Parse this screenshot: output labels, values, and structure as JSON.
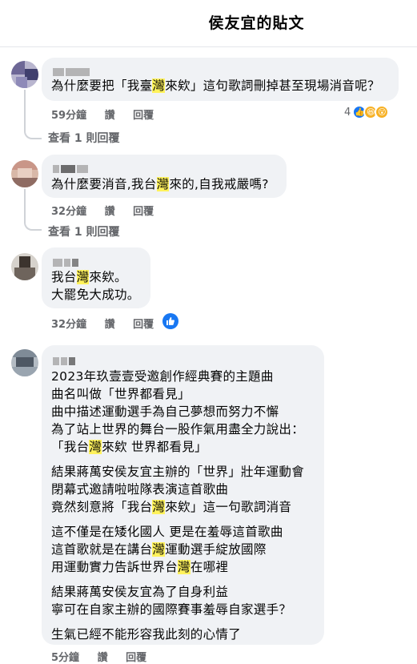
{
  "header": {
    "title": "侯友宜的貼文"
  },
  "comments": [
    {
      "text_lines": [
        [
          "為什麼要把「我臺",
          "灣",
          "來欸」這句歌詞刪掉甚至現場消音呢？"
        ]
      ],
      "time": "59分鐘",
      "like_label": "讚",
      "reply_label": "回覆",
      "reaction_count": "4",
      "reaction_icons": [
        "like-icon",
        "laugh-icon",
        "wow-icon"
      ],
      "view_replies": "查看 1 則回覆"
    },
    {
      "text_lines": [
        [
          "為什麼要消音,我台",
          "灣",
          "來的,自我戒嚴嗎?"
        ]
      ],
      "time": "32分鐘",
      "like_label": "讚",
      "reply_label": "回覆",
      "view_replies": "查看 1 則回覆"
    },
    {
      "text_lines": [
        [
          "我台",
          "灣",
          "來欸。"
        ],
        [
          "大罷免大成功。",
          "",
          ""
        ]
      ],
      "time": "32分鐘",
      "like_label": "讚",
      "reply_label": "回覆",
      "reaction_icons": [
        "like-icon"
      ]
    },
    {
      "text_lines": [
        [
          "2023年玖壹壹受邀創作經典賽的主題曲",
          "",
          ""
        ],
        [
          "曲名叫做「世界都看見」",
          "",
          ""
        ],
        [
          "曲中描述運動選手為自己夢想而努力不懈",
          "",
          ""
        ],
        [
          "為了站上世界的舞台一股作氣用盡全力說出：",
          "",
          ""
        ],
        [
          "「我台",
          "灣",
          "來欸 世界都看見」"
        ],
        [
          "結果蔣萬安侯友宜主辦的「世界」壯年運動會",
          "",
          ""
        ],
        [
          "閉幕式邀請啦啦隊表演這首歌曲",
          "",
          ""
        ],
        [
          "竟然刻意將「我台",
          "灣",
          "來欸」這一句歌詞消音"
        ],
        [
          "這不僅是在矮化國人 更是在羞辱這首歌曲",
          "",
          ""
        ],
        [
          "這首歌就是在講台",
          "灣",
          "運動選手綻放國際"
        ],
        [
          "用運動實力告訴世界台",
          "灣",
          "在哪裡"
        ],
        [
          "結果蔣萬安侯友宜為了自身利益",
          "",
          ""
        ],
        [
          "寧可在自家主辦的國際賽事羞辱自家選手？",
          "",
          ""
        ],
        [
          "生氣已經不能形容我此刻的心情了",
          "",
          ""
        ]
      ],
      "time": "5分鐘",
      "like_label": "讚",
      "reply_label": "回覆"
    }
  ]
}
